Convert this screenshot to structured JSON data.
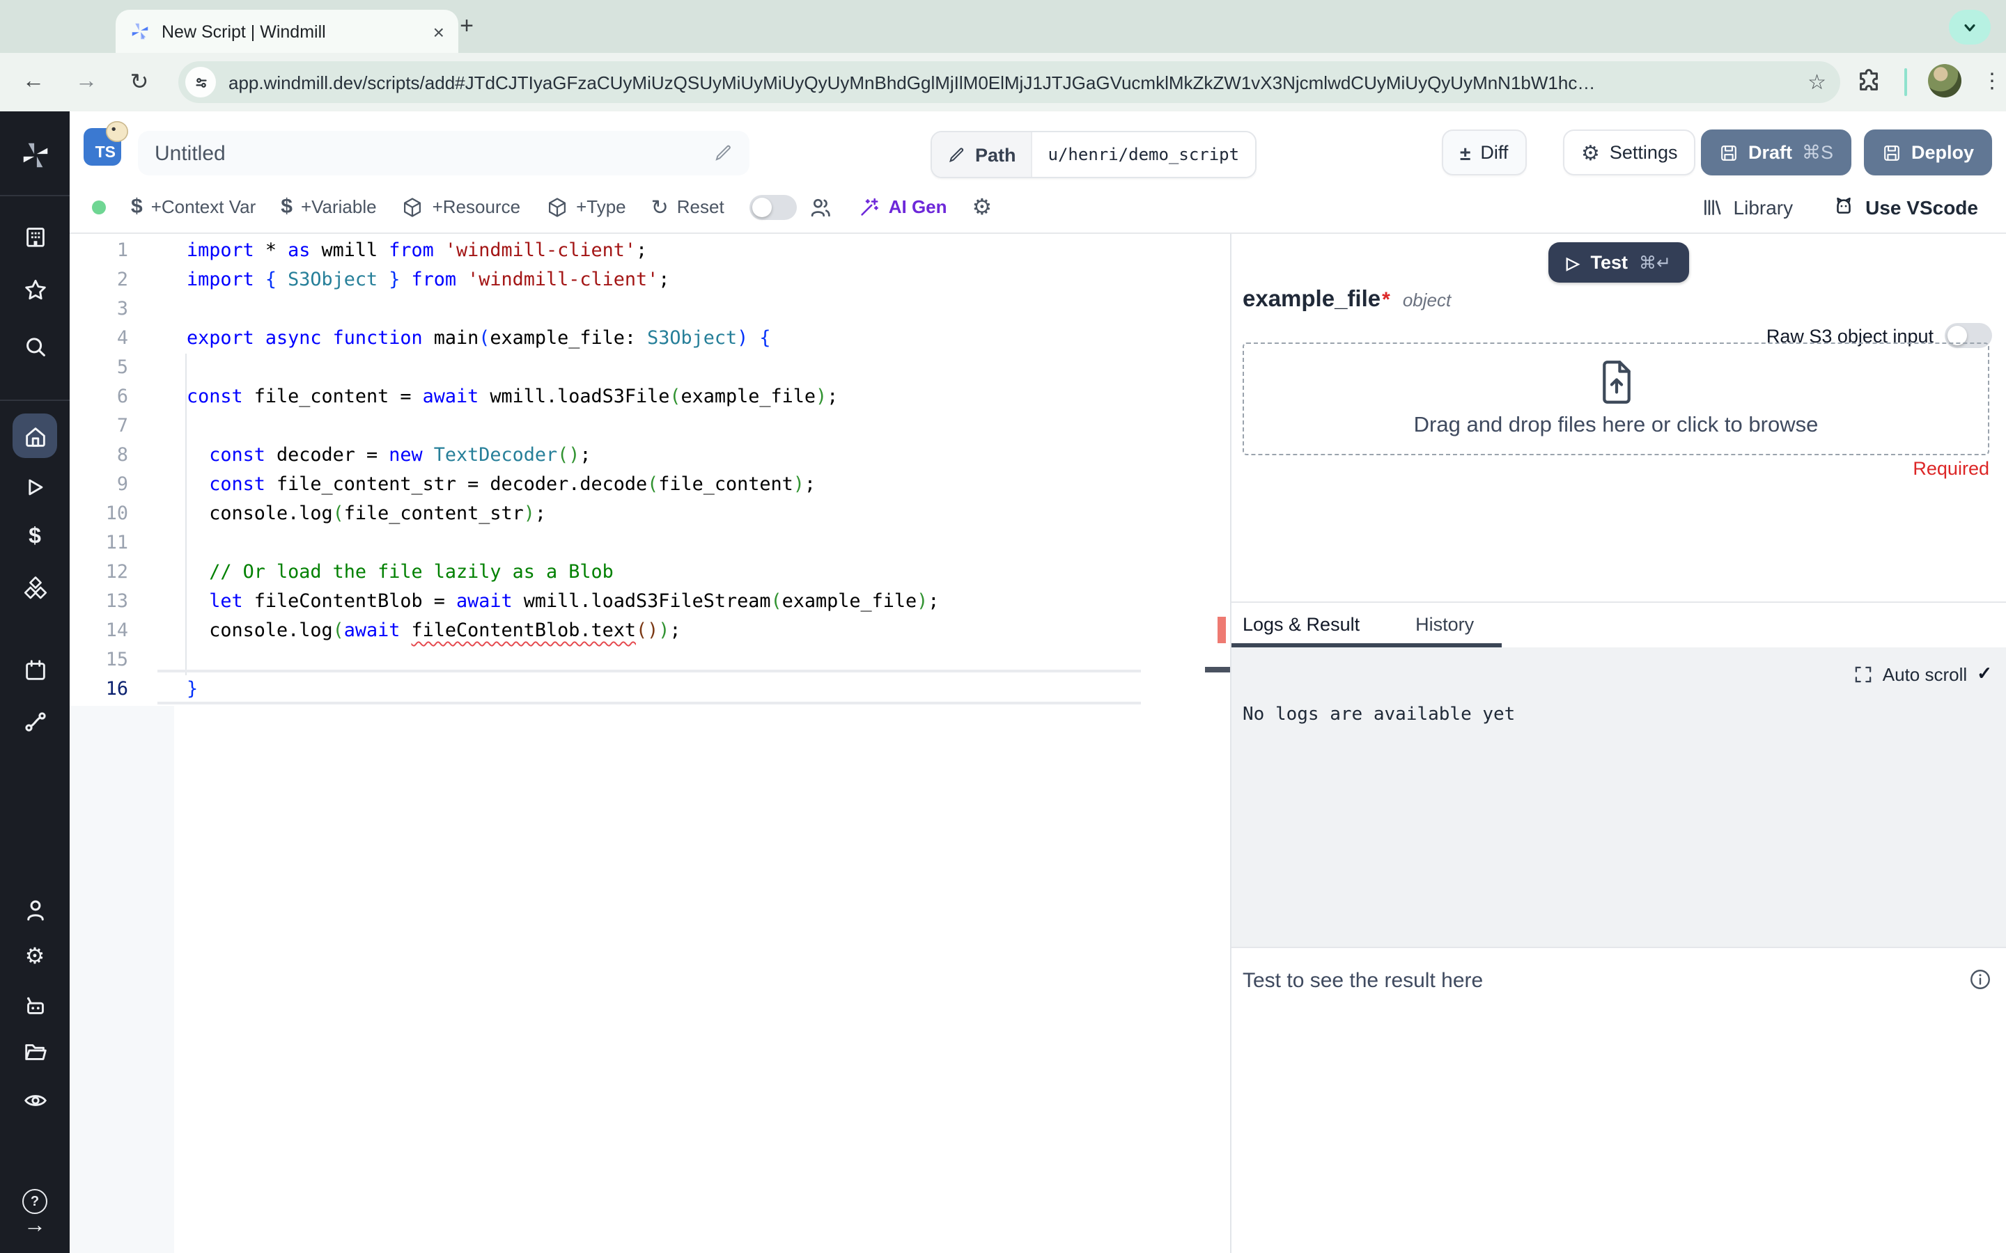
{
  "browser": {
    "tab_title": "New Script | Windmill",
    "close_glyph": "×",
    "new_tab_glyph": "+",
    "back_glyph": "←",
    "forward_glyph": "→",
    "reload_glyph": "↻",
    "url": "app.windmill.dev/scripts/add#JTdCJTIyaGFzaCUyMiUzQSUyMiUyMiUyQyUyMnBhdGglMjIlM0ElMjJ1JTJGaGVucmklMkZkZW1vX3NjcmlwdCUyMiUyQyUyMnN1bW1hc…",
    "star_glyph": "☆",
    "kebab_glyph": "⋮"
  },
  "header": {
    "language_badge": "TS",
    "title": "Untitled",
    "path_label": "Path",
    "path_value": "u/henri/demo_script",
    "diff_icon": "±",
    "diff_label": "Diff",
    "settings_icon": "⚙",
    "settings_label": "Settings",
    "draft_label": "Draft",
    "draft_shortcut": "⌘S",
    "deploy_label": "Deploy"
  },
  "toolbar": {
    "dollar_glyph": "$",
    "items": [
      "+Context Var",
      "+Variable",
      "+Resource",
      "+Type",
      "Reset"
    ],
    "reset_glyph": "↻",
    "ai_gen_label": "AI Gen",
    "gear_glyph": "⚙",
    "library_label": "Library",
    "vscode_label": "Use VScode"
  },
  "sidebar": {
    "icons": [
      "windmill-logo",
      "workspace",
      "favorites",
      "search",
      "home",
      "runs",
      "variables",
      "resources",
      "schedules",
      "flows",
      "user",
      "settings",
      "workers",
      "folders",
      "audit-logs",
      "help",
      "expand"
    ],
    "dollar_glyph": "$",
    "gear_glyph": "⚙",
    "help_glyph": "?",
    "expand_glyph": "→"
  },
  "editor": {
    "active_line": 16,
    "lines": [
      [
        [
          "kw",
          "import"
        ],
        [
          "pl",
          " * "
        ],
        [
          "kw",
          "as"
        ],
        [
          "pl",
          " wmill "
        ],
        [
          "kw",
          "from"
        ],
        [
          "pl",
          " "
        ],
        [
          "str",
          "'windmill-client'"
        ],
        [
          "pl",
          ";"
        ]
      ],
      [
        [
          "kw",
          "import"
        ],
        [
          "pl",
          " "
        ],
        [
          "b1",
          "{"
        ],
        [
          "pl",
          " "
        ],
        [
          "type",
          "S3Object"
        ],
        [
          "pl",
          " "
        ],
        [
          "b1",
          "}"
        ],
        [
          "pl",
          " "
        ],
        [
          "kw",
          "from"
        ],
        [
          "pl",
          " "
        ],
        [
          "str",
          "'windmill-client'"
        ],
        [
          "pl",
          ";"
        ]
      ],
      [],
      [
        [
          "kw",
          "export"
        ],
        [
          "pl",
          " "
        ],
        [
          "kw",
          "async"
        ],
        [
          "pl",
          " "
        ],
        [
          "kw",
          "function"
        ],
        [
          "pl",
          " main"
        ],
        [
          "b1",
          "("
        ],
        [
          "pl",
          "example_file: "
        ],
        [
          "type",
          "S3Object"
        ],
        [
          "b1",
          ")"
        ],
        [
          "pl",
          " "
        ],
        [
          "b1",
          "{"
        ]
      ],
      [],
      [
        [
          "kw",
          "const"
        ],
        [
          "pl",
          " file_content = "
        ],
        [
          "kw",
          "await"
        ],
        [
          "pl",
          " wmill.loadS3File"
        ],
        [
          "b2",
          "("
        ],
        [
          "pl",
          "example_file"
        ],
        [
          "b2",
          ")"
        ],
        [
          "pl",
          ";"
        ]
      ],
      [],
      [
        [
          "pl",
          "  "
        ],
        [
          "kw",
          "const"
        ],
        [
          "pl",
          " decoder = "
        ],
        [
          "kw",
          "new"
        ],
        [
          "pl",
          " "
        ],
        [
          "type",
          "TextDecoder"
        ],
        [
          "b2",
          "()"
        ],
        [
          "pl",
          ";"
        ]
      ],
      [
        [
          "pl",
          "  "
        ],
        [
          "kw",
          "const"
        ],
        [
          "pl",
          " file_content_str = decoder.decode"
        ],
        [
          "b2",
          "("
        ],
        [
          "pl",
          "file_content"
        ],
        [
          "b2",
          ")"
        ],
        [
          "pl",
          ";"
        ]
      ],
      [
        [
          "pl",
          "  console.log"
        ],
        [
          "b2",
          "("
        ],
        [
          "pl",
          "file_content_str"
        ],
        [
          "b2",
          ")"
        ],
        [
          "pl",
          ";"
        ]
      ],
      [],
      [
        [
          "pl",
          "  "
        ],
        [
          "com",
          "// Or load the file lazily as a Blob"
        ]
      ],
      [
        [
          "pl",
          "  "
        ],
        [
          "kw",
          "let"
        ],
        [
          "pl",
          " fileContentBlob = "
        ],
        [
          "kw",
          "await"
        ],
        [
          "pl",
          " wmill.loadS3FileStream"
        ],
        [
          "b2",
          "("
        ],
        [
          "pl",
          "example_file"
        ],
        [
          "b2",
          ")"
        ],
        [
          "pl",
          ";"
        ]
      ],
      [
        [
          "pl",
          "  console.log"
        ],
        [
          "b2",
          "("
        ],
        [
          "kw",
          "await"
        ],
        [
          "pl",
          " "
        ],
        [
          "sq",
          "fileContentBlob.text"
        ],
        [
          "b3",
          "()"
        ],
        [
          "b2",
          ")"
        ],
        [
          "pl",
          ";"
        ]
      ],
      [],
      [
        [
          "b1",
          "}"
        ]
      ]
    ]
  },
  "panel": {
    "test_play_glyph": "▷",
    "test_label": "Test",
    "test_shortcut": "⌘↵",
    "arg_name": "example_file",
    "required_star": "*",
    "arg_type": "object",
    "raw_s3_label": "Raw S3 object input",
    "dropzone_text": "Drag and drop files here or click to browse",
    "required_label": "Required",
    "tab_logs": "Logs & Result",
    "tab_history": "History",
    "autoscroll_label": "Auto scroll",
    "check_glyph": "✓",
    "no_logs_text": "No logs are available yet",
    "result_placeholder": "Test to see the result here"
  },
  "colors": {
    "accent_button": "#617794",
    "test_button": "#333e56",
    "ai_purple": "#6d28d9",
    "status_green": "#6fd693",
    "error_red": "#dc2626",
    "sidebar_bg": "#1a1d24",
    "sidebar_active": "#3e4c66",
    "chrome_strip": "#d7e3dd",
    "logs_bg": "#f0f2f4"
  }
}
